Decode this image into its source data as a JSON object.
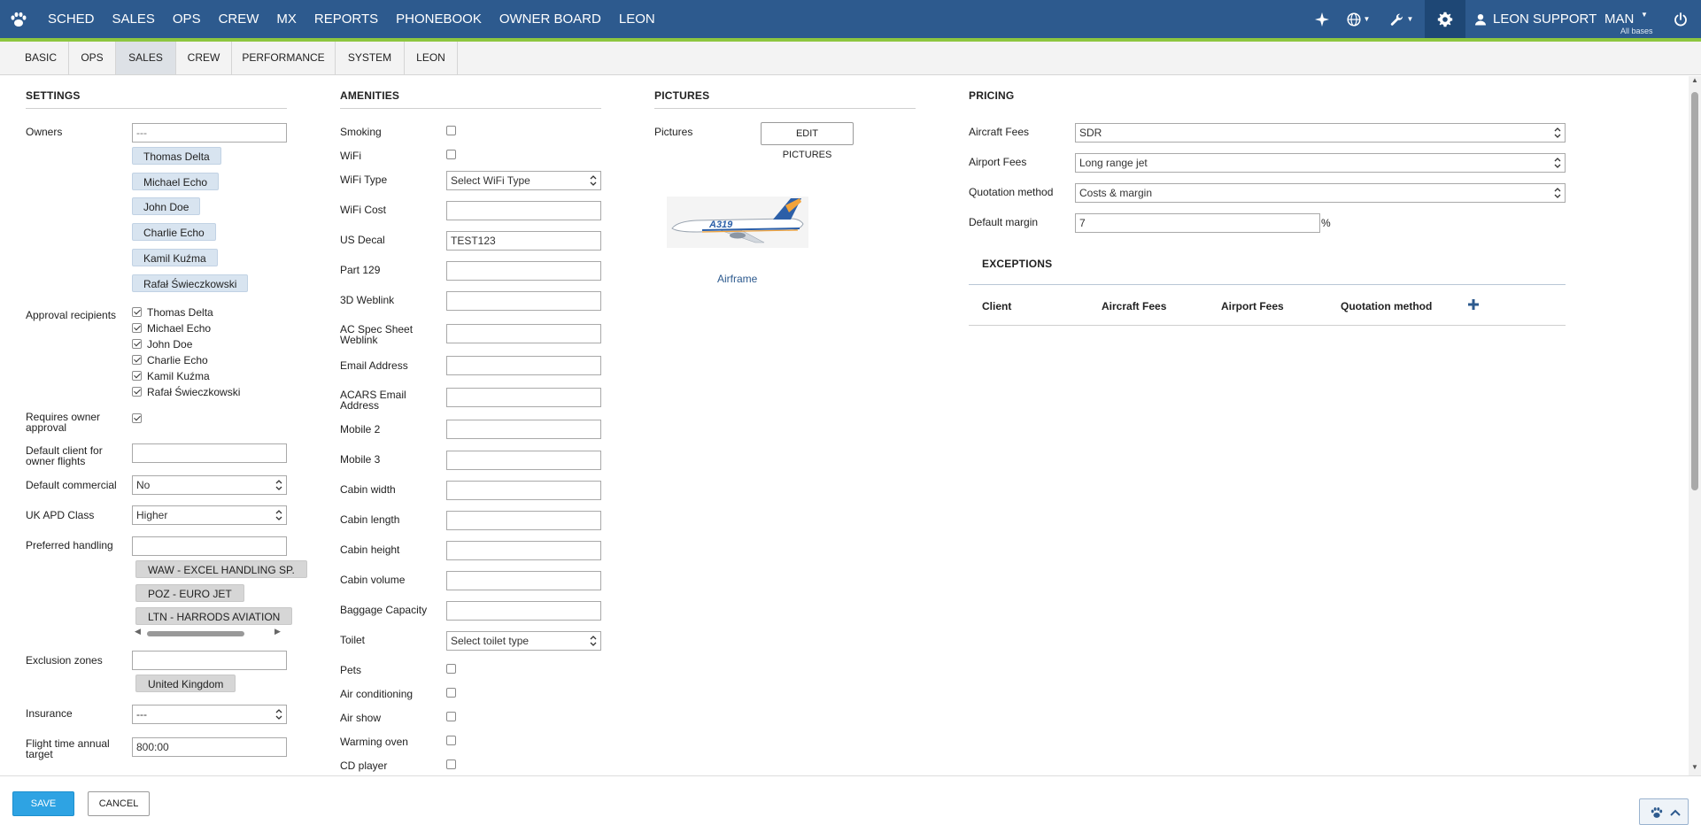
{
  "nav": {
    "items": [
      "SCHED",
      "SALES",
      "OPS",
      "CREW",
      "MX",
      "REPORTS",
      "PHONEBOOK",
      "OWNER BOARD",
      "LEON"
    ],
    "user": "LEON SUPPORT",
    "base": "MAN",
    "base_sub": "All bases"
  },
  "tabs": [
    "BASIC",
    "OPS",
    "SALES",
    "CREW",
    "PERFORMANCE",
    "SYSTEM",
    "LEON"
  ],
  "active_tab": "SALES",
  "settings": {
    "title": "SETTINGS",
    "owners_label": "Owners",
    "owners_placeholder": "---",
    "owners": [
      "Thomas Delta",
      "Michael Echo",
      "John Doe",
      "Charlie Echo",
      "Kamil Kuźma",
      "Rafał Świeczkowski"
    ],
    "approval_label": "Approval recipients",
    "approval": [
      "Thomas Delta",
      "Michael Echo",
      "John Doe",
      "Charlie Echo",
      "Kamil Kuźma",
      "Rafał Świeczkowski"
    ],
    "requires_owner_approval_label": "Requires owner approval",
    "default_client_label": "Default client for owner flights",
    "default_commercial_label": "Default commercial",
    "default_commercial_value": "No",
    "uk_apd_label": "UK APD Class",
    "uk_apd_value": "Higher",
    "preferred_handling_label": "Preferred handling",
    "handling": [
      "WAW - EXCEL HANDLING SP.",
      "POZ - EURO JET",
      "LTN - HARRODS AVIATION"
    ],
    "exclusion_label": "Exclusion zones",
    "exclusion_chip": "United Kingdom",
    "insurance_label": "Insurance",
    "insurance_value": "---",
    "flight_time_label": "Flight time annual target",
    "flight_time_value": "800:00"
  },
  "amenities": {
    "title": "AMENITIES",
    "smoking": "Smoking",
    "wifi": "WiFi",
    "wifi_type": "WiFi Type",
    "wifi_type_value": "Select WiFi Type",
    "wifi_cost": "WiFi Cost",
    "us_decal": "US Decal",
    "us_decal_value": "TEST123",
    "part129": "Part 129",
    "weblink3d": "3D Weblink",
    "ac_spec": "AC Spec Sheet Weblink",
    "email": "Email Address",
    "acars": "ACARS Email Address",
    "mobile2": "Mobile 2",
    "mobile3": "Mobile 3",
    "cabin_width": "Cabin width",
    "cabin_length": "Cabin length",
    "cabin_height": "Cabin height",
    "cabin_volume": "Cabin volume",
    "baggage": "Baggage Capacity",
    "toilet": "Toilet",
    "toilet_value": "Select toilet type",
    "pets": "Pets",
    "aircon": "Air conditioning",
    "airshow": "Air show",
    "oven": "Warming oven",
    "cd": "CD player"
  },
  "pictures": {
    "title": "PICTURES",
    "label": "Pictures",
    "edit_button": "EDIT PICTURES",
    "caption": "Airframe",
    "plane_text": "A319"
  },
  "pricing": {
    "title": "PRICING",
    "aircraft_fees_label": "Aircraft Fees",
    "aircraft_fees_value": "SDR",
    "airport_fees_label": "Airport Fees",
    "airport_fees_value": "Long range jet",
    "quotation_label": "Quotation method",
    "quotation_value": "Costs & margin",
    "margin_label": "Default margin",
    "margin_value": "7",
    "margin_unit": "%",
    "exceptions_title": "EXCEPTIONS",
    "exceptions_cols": [
      "Client",
      "Aircraft Fees",
      "Airport Fees",
      "Quotation method"
    ]
  },
  "footer": {
    "save": "SAVE",
    "cancel": "CANCEL"
  },
  "colors": {
    "topbar": "#2d5a8e",
    "accent_line": "#8dc63f",
    "primary_button": "#2ea3e3"
  }
}
